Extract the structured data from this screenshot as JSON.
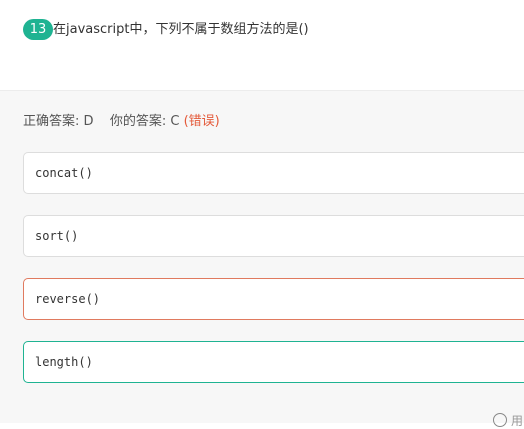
{
  "question": {
    "number": "13",
    "text": "在javascript中，下列不属于数组方法的是()"
  },
  "result": {
    "correct_label": "正确答案:",
    "correct_value": "D",
    "yours_label": "你的答案:",
    "yours_value": "C",
    "status": "(错误)"
  },
  "options": [
    {
      "text": "concat()",
      "state": "normal"
    },
    {
      "text": "sort()",
      "state": "normal"
    },
    {
      "text": "reverse()",
      "state": "wrong"
    },
    {
      "text": "length()",
      "state": "correct"
    }
  ],
  "footer": {
    "partial_label": "用"
  },
  "colors": {
    "accent": "#1fb392",
    "error": "#e45a3a"
  }
}
